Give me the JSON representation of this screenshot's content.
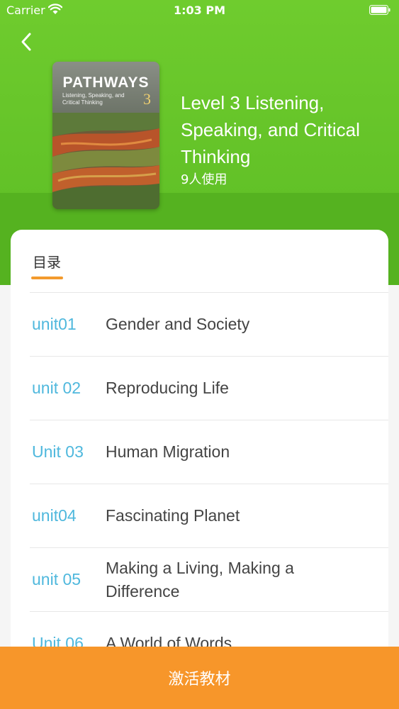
{
  "status_bar": {
    "carrier": "Carrier",
    "time": "1:03 PM"
  },
  "header": {
    "book_title": "Level 3 Listening, Speaking, and Critical Thinking",
    "users": "9人使用",
    "cover": {
      "brand": "PATHWAYS",
      "subtitle": "Listening, Speaking, and Critical Thinking",
      "level": "3"
    }
  },
  "contents": {
    "tab_label": "目录",
    "units": [
      {
        "number": "unit01",
        "name": "Gender and Society"
      },
      {
        "number": "unit 02",
        "name": "Reproducing Life"
      },
      {
        "number": "Unit 03",
        "name": "Human Migration"
      },
      {
        "number": "unit04",
        "name": "Fascinating Planet"
      },
      {
        "number": "unit 05",
        "name": "Making a Living, Making a Difference"
      },
      {
        "number": "Unit 06",
        "name": "A World of Words"
      }
    ]
  },
  "footer": {
    "activate_label": "激活教材"
  },
  "colors": {
    "header_green": "#6fcc2e",
    "unit_number_blue": "#4fb8dd",
    "accent_orange": "#f7962a"
  }
}
